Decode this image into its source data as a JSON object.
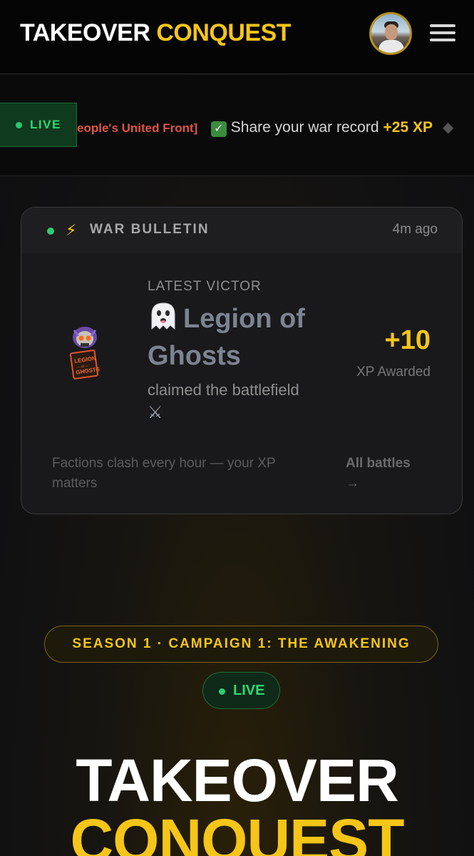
{
  "header": {
    "brand_white": "TAKEOVER",
    "brand_yellow": "CONQUEST",
    "avatar_alt": "User avatar",
    "menu_icon": "hamburger-menu-icon"
  },
  "ticker": {
    "live_label": "LIVE",
    "faction_fragment": "eople's United Front]",
    "check_icon": "✓",
    "share_text": "Share your war record",
    "xp_text": "+25 XP",
    "separator": "◆"
  },
  "bulletin": {
    "label": "WAR BULLETIN",
    "time_ago": "4m ago",
    "latest_label": "LATEST VICTOR",
    "victor_name": "Legion of Ghosts",
    "claimed_text": "claimed the battlefield",
    "swords_icon": "⚔",
    "xp_value": "+10",
    "xp_label": "XP Awarded",
    "footer_note": "Factions clash every hour — your XP matters",
    "all_battles": "All battles →"
  },
  "season": {
    "pill_text": "SEASON 1 · CAMPAIGN 1: THE AWAKENING",
    "live_label": "LIVE"
  },
  "hero": {
    "line1": "TAKEOVER",
    "line2": "CONQUEST"
  },
  "colors": {
    "accent_yellow": "#f5c518",
    "live_green": "#2fd774",
    "faction_red": "#e05545",
    "background": "#0b0b0c"
  }
}
